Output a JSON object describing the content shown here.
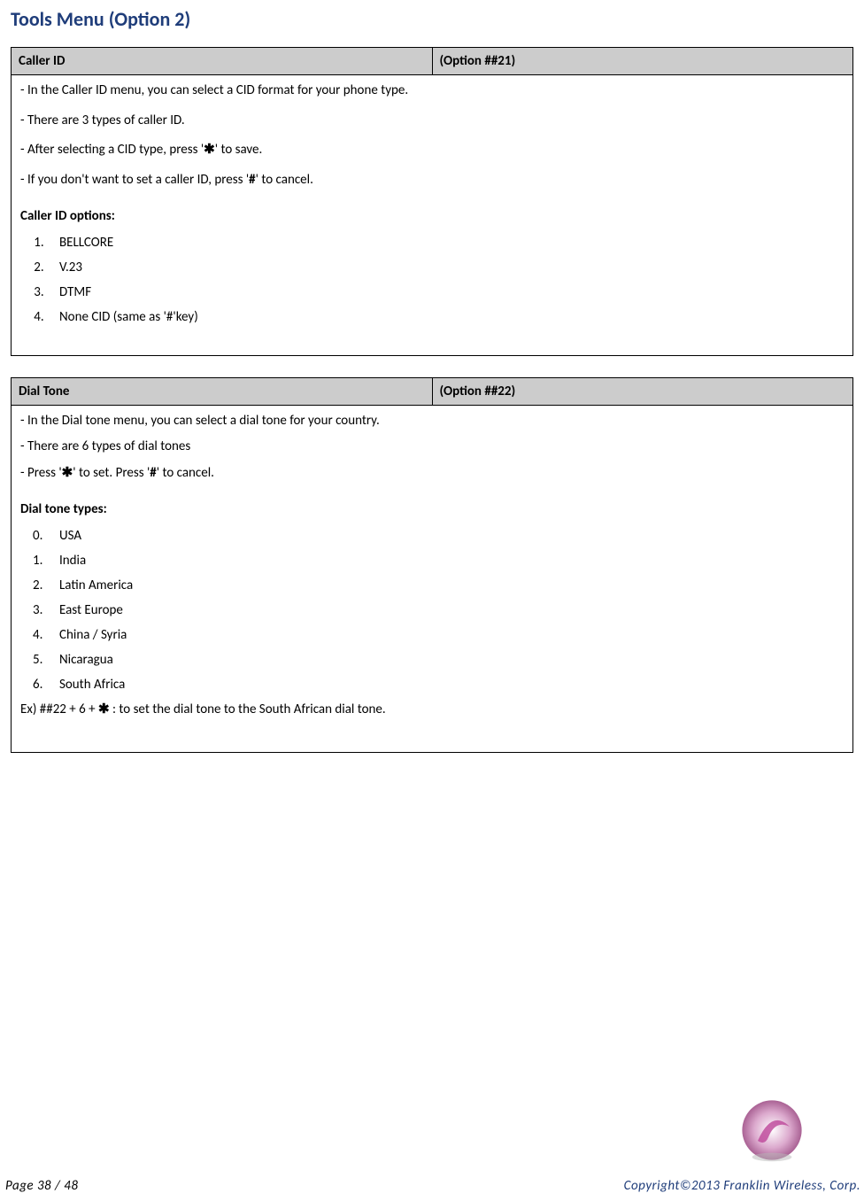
{
  "title": "Tools Menu (Option 2)",
  "section1": {
    "name": "Caller ID",
    "option": "(Option ##21)",
    "lines": [
      "- In the Caller ID menu, you can select a CID format for your phone type.",
      "- There are 3 types of caller ID.",
      "- After selecting a CID type, press '✱' to save.",
      "- If you don't want to set a caller ID, press '#' to cancel."
    ],
    "subhead": "Caller ID options:",
    "items": [
      "BELLCORE",
      "V.23",
      "DTMF",
      "None CID (same as '#'key)"
    ]
  },
  "section2": {
    "name": "Dial Tone",
    "option": "(Option ##22)",
    "lines": [
      "- In the Dial tone menu, you can select a dial tone for your country.",
      "- There are 6 types of dial tones",
      "- Press '✱' to set. Press '#' to cancel."
    ],
    "subhead": "Dial tone types:",
    "items": [
      "USA",
      "India",
      "Latin America",
      "East Europe",
      "China / Syria",
      "Nicaragua",
      "South Africa"
    ],
    "example": "Ex) ##22 + 6 + ✱ : to set the dial tone to the South African dial tone."
  },
  "footer": {
    "page": "Page  38  /  48",
    "copyright": "Copyright©2013  Franklin  Wireless, Corp."
  }
}
